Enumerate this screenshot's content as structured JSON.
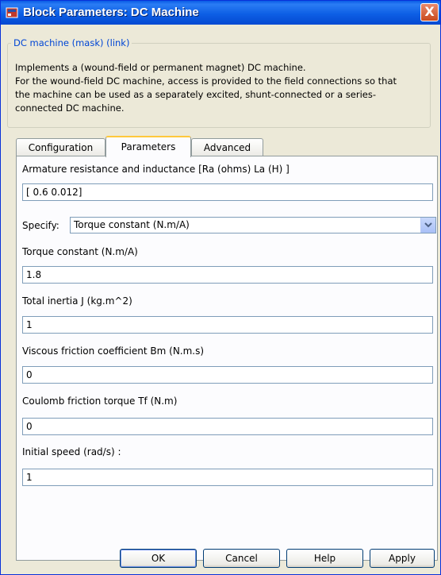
{
  "window": {
    "title": "Block Parameters: DC Machine",
    "close_glyph": "X",
    "accent_color": "#0a5ce6",
    "icons": {
      "app": "simulink-block-icon",
      "close": "close-icon",
      "dropdown": "chevron-down-icon"
    }
  },
  "mask": {
    "legend": "DC machine (mask) (link)",
    "lines": [
      "Implements a (wound-field or permanent magnet) DC machine.",
      "For the wound-field DC machine, access is provided to the field connections so that",
      "the machine can be used as a separately excited, shunt-connected or a series-",
      "connected  DC machine."
    ]
  },
  "tabs": [
    {
      "label": "Configuration",
      "active": false
    },
    {
      "label": "Parameters",
      "active": true
    },
    {
      "label": "Advanced",
      "active": false
    }
  ],
  "params": {
    "armature": {
      "label": "Armature resistance and inductance [Ra (ohms) La (H) ]",
      "value": "[ 0.6  0.012]"
    },
    "specify": {
      "label": "Specify:",
      "value": "Torque constant (N.m/A)"
    },
    "torque_constant": {
      "label": "Torque constant (N.m/A)",
      "value": "1.8"
    },
    "inertia": {
      "label": "Total inertia J (kg.m^2)",
      "value": "1"
    },
    "viscous": {
      "label": "Viscous friction coefficient Bm (N.m.s)",
      "value": "0"
    },
    "coulomb": {
      "label": "Coulomb friction torque Tf (N.m)",
      "value": "0"
    },
    "initial_speed": {
      "label": "Initial speed (rad/s) :",
      "value": "1"
    }
  },
  "buttons": {
    "ok": "OK",
    "cancel": "Cancel",
    "help": "Help",
    "apply": "Apply"
  }
}
